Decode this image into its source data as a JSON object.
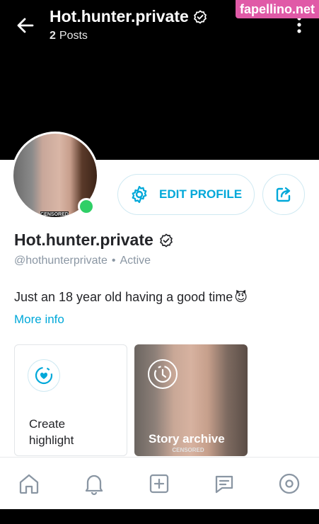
{
  "header": {
    "title": "Hot.hunter.private",
    "posts_count": "2",
    "posts_label": "Posts",
    "watermark": "fapellino.net"
  },
  "avatar": {
    "censor_label": "CENSORED",
    "status": "online"
  },
  "actions": {
    "edit_label": "EDIT PROFILE"
  },
  "profile": {
    "name": "Hot.hunter.private",
    "handle": "@hothunterprivate",
    "separator": "•",
    "activity": "Active",
    "bio": "Just an 18 year old having a good time",
    "bio_emoji": "😈",
    "more_info": "More info"
  },
  "highlights": {
    "create_label_line1": "Create",
    "create_label_line2": "highlight",
    "archive_label": "Story archive",
    "archive_censor": "CENSORED"
  },
  "nav": {
    "items": [
      "home-icon",
      "bell-icon",
      "plus-square-icon",
      "message-icon",
      "profile-icon"
    ]
  },
  "colors": {
    "accent": "#00a8d9",
    "online": "#2fcf66",
    "text": "#242529",
    "muted": "#8a96a3",
    "watermark": "#e05aa7"
  }
}
